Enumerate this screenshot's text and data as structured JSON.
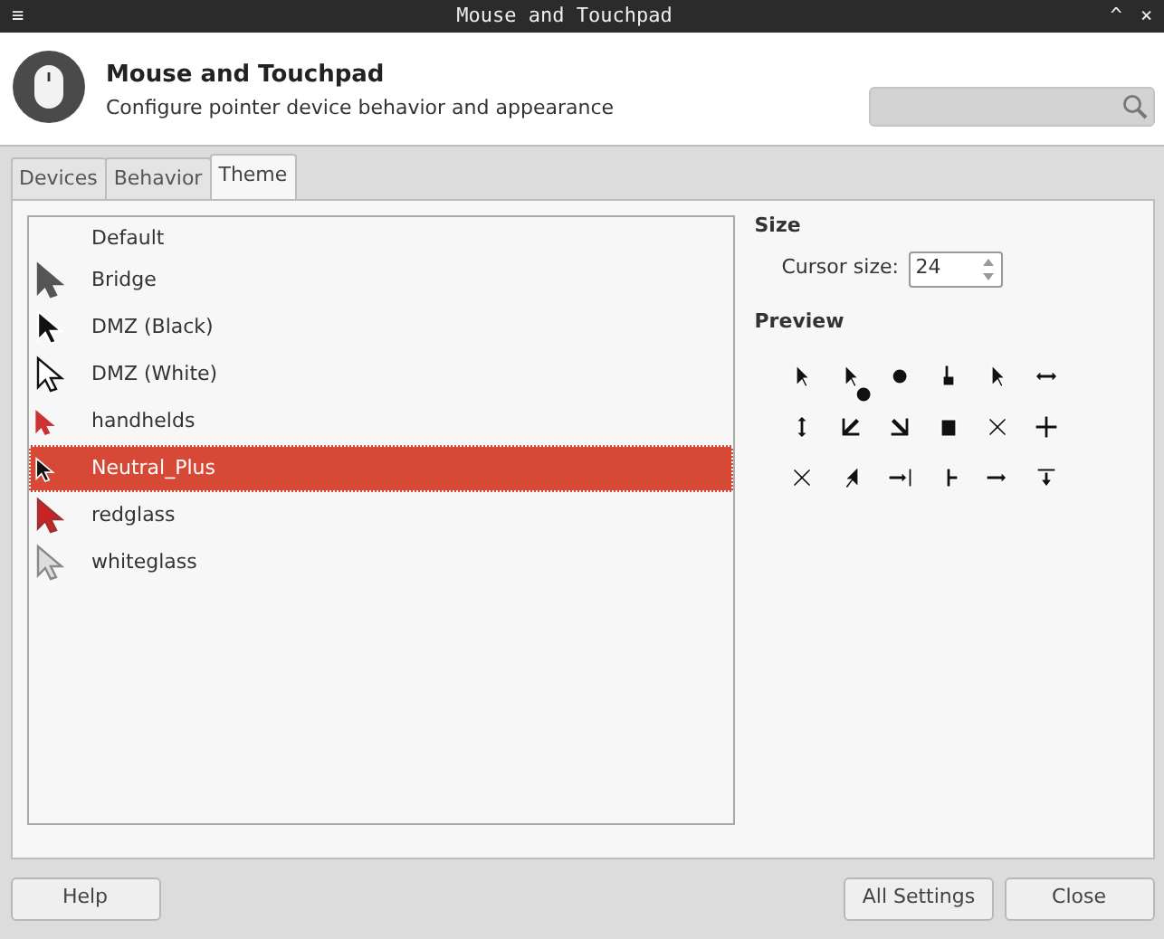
{
  "window": {
    "title": "Mouse and Touchpad",
    "menu_glyph": "≡",
    "controls": [
      "^",
      "×"
    ]
  },
  "header": {
    "title": "Mouse and Touchpad",
    "subtitle": "Configure pointer device behavior and appearance"
  },
  "tabs": [
    {
      "label": "Devices",
      "selected": false
    },
    {
      "label": "Behavior",
      "selected": false
    },
    {
      "label": "Theme",
      "selected": true
    }
  ],
  "themes": [
    {
      "name": "Default",
      "kind": "none",
      "selected": false
    },
    {
      "name": "Bridge",
      "kind": "dark",
      "selected": false
    },
    {
      "name": "DMZ (Black)",
      "kind": "black",
      "selected": false
    },
    {
      "name": "DMZ (White)",
      "kind": "white",
      "selected": false
    },
    {
      "name": "handhelds",
      "kind": "redsmall",
      "selected": false
    },
    {
      "name": "Neutral_Plus",
      "kind": "blacksmall",
      "selected": true
    },
    {
      "name": "redglass",
      "kind": "red",
      "selected": false
    },
    {
      "name": "whiteglass",
      "kind": "glass",
      "selected": false
    }
  ],
  "size": {
    "heading": "Size",
    "label": "Cursor size:",
    "value": "24"
  },
  "preview": {
    "heading": "Preview"
  },
  "buttons": [
    {
      "label": "Help"
    },
    {
      "label": "All Settings"
    },
    {
      "label": "Close"
    }
  ]
}
